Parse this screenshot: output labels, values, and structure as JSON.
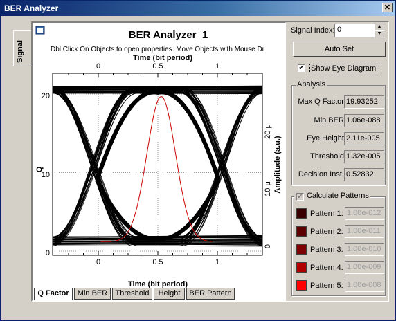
{
  "window": {
    "title": "BER Analyzer",
    "close_glyph": "✕"
  },
  "side_tab": {
    "label": "Signal"
  },
  "plot": {
    "title": "BER Analyzer_1",
    "subtitle": "Dbl Click On Objects to open properties.  Move Objects with Mouse Dr",
    "top_axis_title": "Time (bit period)",
    "bottom_axis_title": "Time (bit period)",
    "left_axis_title": "Q",
    "right_axis_title": "Amplitude (a.u.)",
    "top_ticks": [
      "0",
      "0.5",
      "1"
    ],
    "bottom_ticks": [
      "0",
      "0.5",
      "1"
    ],
    "left_ticks": [
      "20",
      "10",
      "0"
    ],
    "right_ticks": [
      "20 μ",
      "10 μ",
      "0"
    ]
  },
  "bottom_tabs": [
    "Q Factor",
    "Min BER",
    "Threshold",
    "Height",
    "BER Pattern"
  ],
  "controls": {
    "signal_index_label": "Signal Index:",
    "signal_index_value": "0",
    "auto_set_label": "Auto Set",
    "show_eye_label": "Show Eye Diagram",
    "show_eye_checked": true
  },
  "analysis": {
    "title": "Analysis",
    "rows": [
      {
        "label": "Max Q Factor:",
        "value": "19.93252"
      },
      {
        "label": "Min BER:",
        "value": "1.06e-088"
      },
      {
        "label": "Eye Height:",
        "value": "2.11e-005"
      },
      {
        "label": "Threshold:",
        "value": "1.32e-005"
      },
      {
        "label": "Decision Inst.:",
        "value": "0.52832"
      }
    ]
  },
  "patterns": {
    "title": "Calculate Patterns",
    "checked": true,
    "rows": [
      {
        "label": "Pattern 1:",
        "value": "1.00e-012",
        "color": "#3a0000"
      },
      {
        "label": "Pattern 2:",
        "value": "1.00e-011",
        "color": "#5c0000"
      },
      {
        "label": "Pattern 3:",
        "value": "1.00e-010",
        "color": "#800000"
      },
      {
        "label": "Pattern 4:",
        "value": "1.00e-009",
        "color": "#b00000"
      },
      {
        "label": "Pattern 5:",
        "value": "1.00e-008",
        "color": "#ff0000"
      }
    ]
  },
  "colors": {
    "title_bar": "#0a246a",
    "q_curve": "#cc0000",
    "eye_traces": "#000000"
  }
}
